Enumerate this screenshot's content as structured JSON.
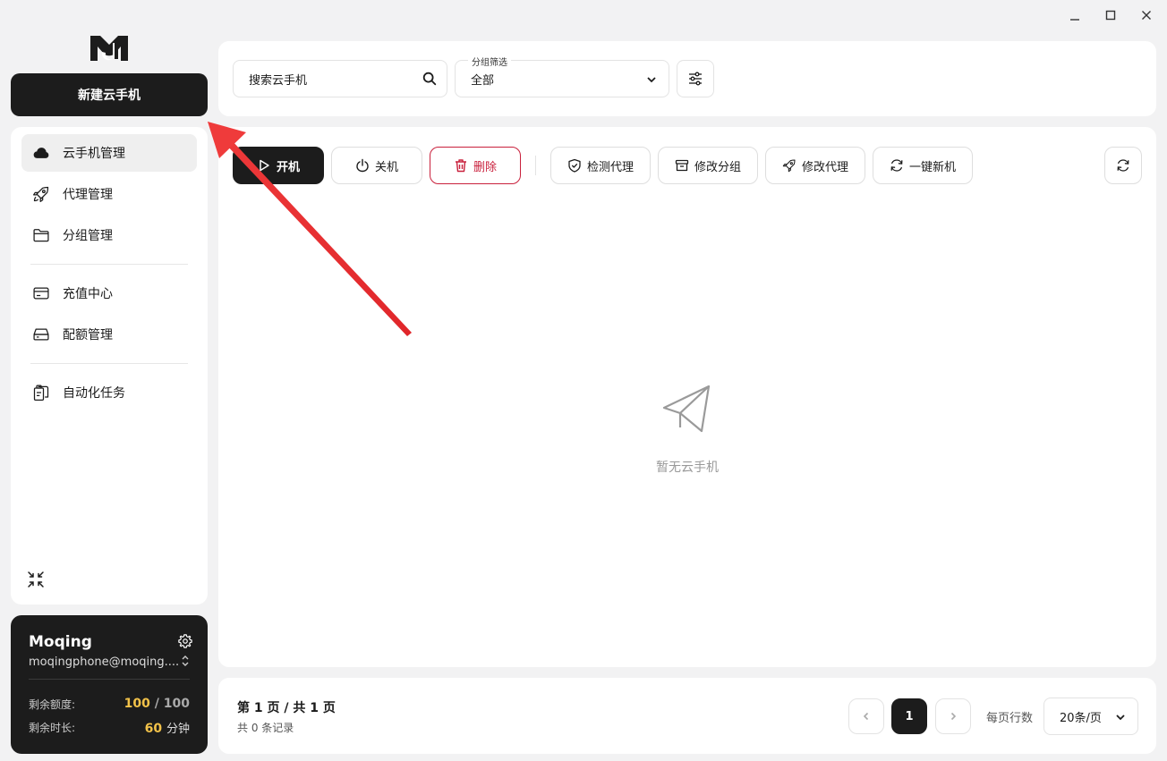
{
  "window": {
    "controls": [
      "minimize-icon",
      "maximize-icon",
      "close-icon"
    ]
  },
  "sidebar": {
    "new_button": "新建云手机",
    "items": [
      {
        "label": "云手机管理",
        "icon": "cloud-icon",
        "active": true
      },
      {
        "label": "代理管理",
        "icon": "rocket-icon"
      },
      {
        "label": "分组管理",
        "icon": "folder-icon"
      },
      {
        "label": "充值中心",
        "icon": "credit-card-icon"
      },
      {
        "label": "配额管理",
        "icon": "server-icon"
      },
      {
        "label": "自动化任务",
        "icon": "clipboard-icon"
      }
    ]
  },
  "account": {
    "name": "Moqing",
    "email": "moqingphone@moqing....",
    "quota_label": "剩余额度:",
    "quota_used": "100",
    "quota_sep": " / ",
    "quota_total": "100",
    "time_label": "剩余时长:",
    "time_value": "60",
    "time_unit": "分钟"
  },
  "filter": {
    "search_text": "搜索云手机",
    "group_label": "分组筛选",
    "group_value": "全部"
  },
  "toolbar": {
    "start": "开机",
    "shutdown": "关机",
    "delete": "删除",
    "check_proxy": "检测代理",
    "edit_group": "修改分组",
    "edit_proxy": "修改代理",
    "one_click_new": "一键新机"
  },
  "empty": {
    "text": "暂无云手机"
  },
  "pagination": {
    "page_info": "第 1 页 / 共 1 页",
    "records": "共 0 条记录",
    "current": "1",
    "rows_label": "每页行数",
    "rows_value": "20条/页"
  },
  "colors": {
    "dark": "#1c1c1c",
    "danger": "#c9203c",
    "gold": "#f2c249",
    "arrow": "#ef3b3b"
  }
}
